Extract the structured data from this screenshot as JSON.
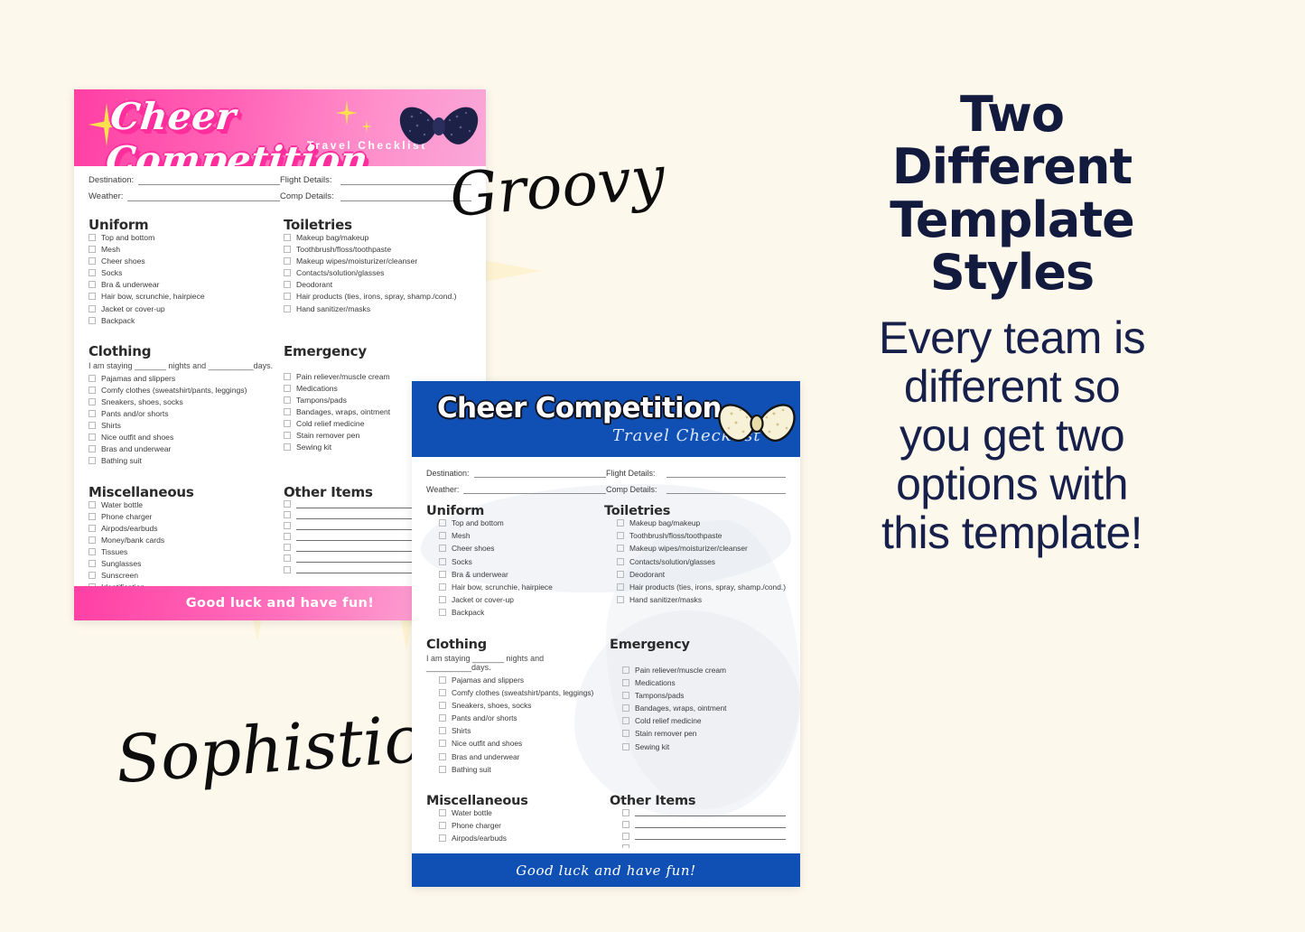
{
  "background_color": "#fdf8ec",
  "right_panel": {
    "headline_lines": [
      "Two",
      "Different",
      "Template",
      "Styles"
    ],
    "subcopy_lines": [
      "Every team is",
      "different so",
      "you get two",
      "options with",
      "this template!"
    ],
    "headline_color": "#121a3e"
  },
  "script_labels": {
    "groovy": "Groovy",
    "sophisticated": "Sophisticated"
  },
  "shared": {
    "meta": {
      "destination_label": "Destination:",
      "weather_label": "Weather:",
      "flight_label": "Flight Details:",
      "comp_label": "Comp Details:"
    },
    "sections": {
      "uniform": {
        "title": "Uniform",
        "items": [
          "Top and bottom",
          "Mesh",
          "Cheer shoes",
          "Socks",
          "Bra & underwear",
          "Hair bow, scrunchie, hairpiece",
          "Jacket or cover-up",
          "Backpack"
        ]
      },
      "toiletries": {
        "title": "Toiletries",
        "items": [
          "Makeup bag/makeup",
          "Toothbrush/floss/toothpaste",
          "Makeup wipes/moisturizer/cleanser",
          "Contacts/solution/glasses",
          "Deodorant",
          "Hair products (ties, irons, spray, shamp./cond.)",
          "Hand sanitizer/masks"
        ]
      },
      "clothing": {
        "title": "Clothing",
        "subtitle": "I am staying _______ nights and __________days.",
        "items": [
          "Pajamas and slippers",
          "Comfy clothes (sweatshirt/pants, leggings)",
          "Sneakers, shoes, socks",
          "Pants and/or shorts",
          "Shirts",
          "Nice outfit and shoes",
          "Bras and underwear",
          "Bathing suit"
        ]
      },
      "emergency": {
        "title": "Emergency",
        "items": [
          "Pain reliever/muscle cream",
          "Medications",
          "Tampons/pads",
          "Bandages, wraps, ointment",
          "Cold relief medicine",
          "Stain remover pen",
          "Sewing kit"
        ]
      },
      "miscellaneous": {
        "title": "Miscellaneous",
        "items": [
          "Water bottle",
          "Phone charger",
          "Airpods/earbuds",
          "Money/bank cards",
          "Tissues",
          "Sunglasses",
          "Sunscreen",
          "Identification"
        ]
      },
      "other_items": {
        "title": "Other Items",
        "blank_rows": 7
      }
    }
  },
  "pink_template": {
    "style_name": "Groovy",
    "title": "Cheer Competition",
    "subtitle": "Travel Checklist",
    "footer_text": "Good luck and have fun!",
    "banner_color_start": "#ff3fa4",
    "banner_color_end": "#f9a8d8",
    "bow_color": "#1d2047",
    "sparkle_color": "#ffe14d"
  },
  "blue_template": {
    "style_name": "Sophisticated",
    "title": "Cheer Competition",
    "subtitle": "Travel Checklist",
    "footer_text": "Good luck and have fun!",
    "banner_color": "#1050b5",
    "bow_color": "#f7f1d8",
    "bow_outline": "#141414"
  }
}
